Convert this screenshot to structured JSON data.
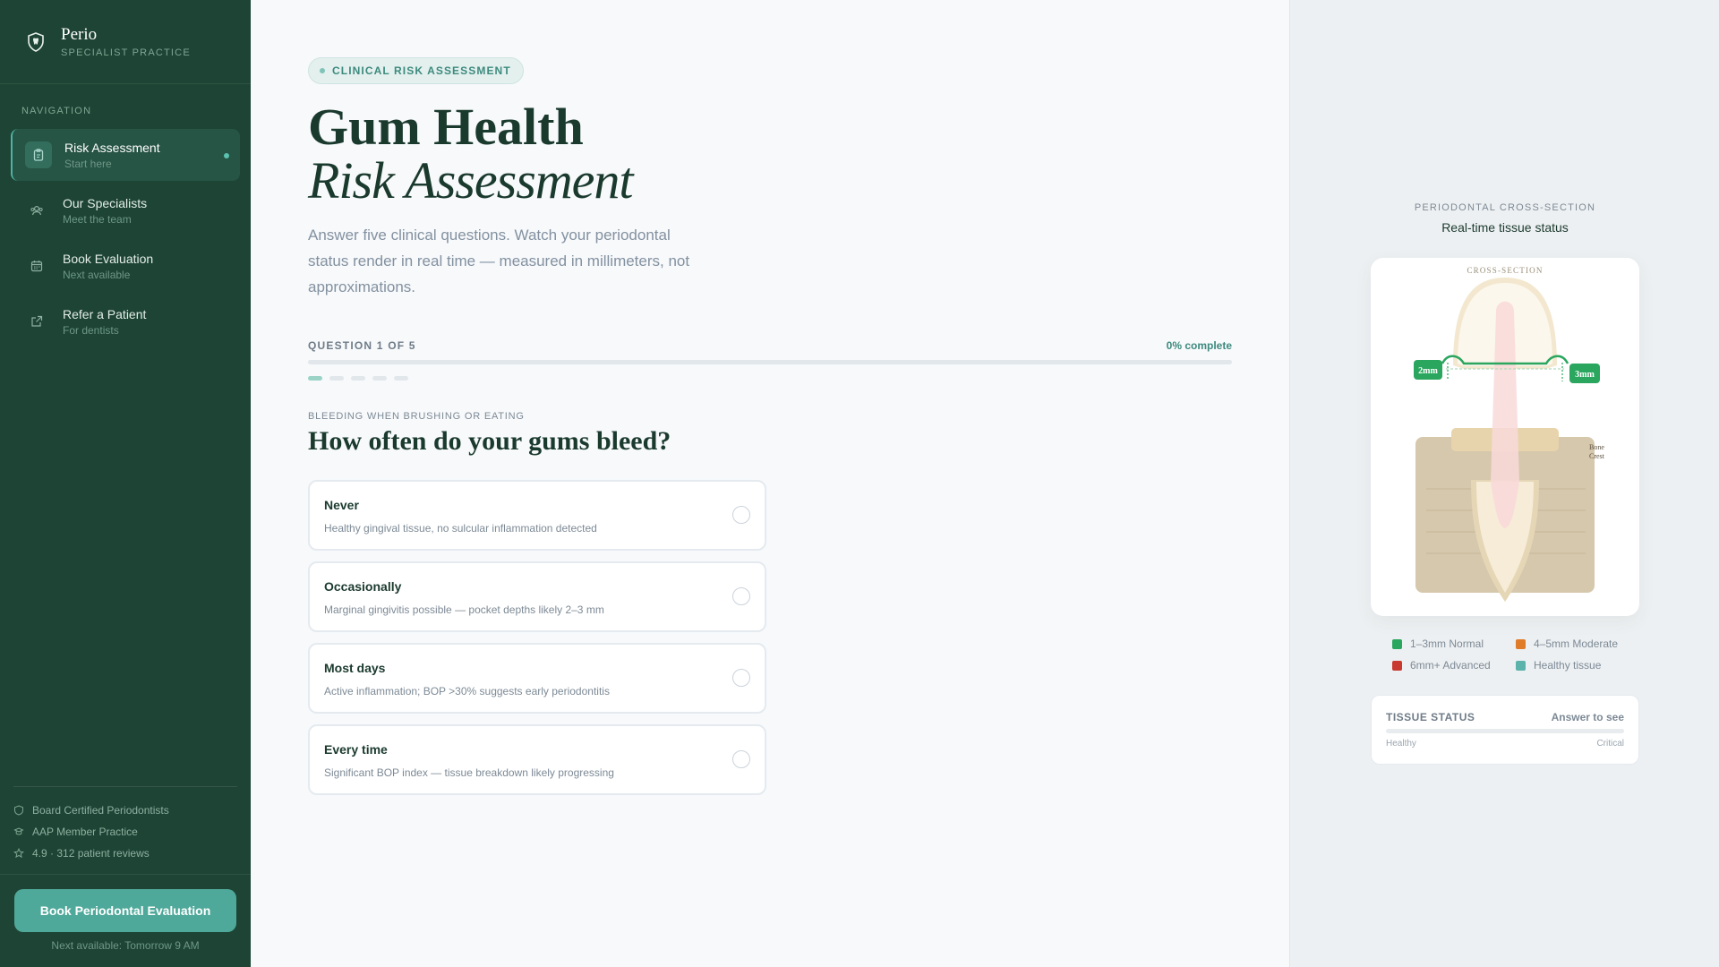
{
  "brand": {
    "name": "Perio",
    "tagline": "SPECIALIST PRACTICE"
  },
  "sidebar": {
    "nav_label": "NAVIGATION",
    "items": [
      {
        "title": "Risk Assessment",
        "subtitle": "Start here",
        "icon": "clipboard-icon",
        "active": true
      },
      {
        "title": "Our Specialists",
        "subtitle": "Meet the team",
        "icon": "team-icon",
        "active": false
      },
      {
        "title": "Book Evaluation",
        "subtitle": "Next available",
        "icon": "calendar-icon",
        "active": false
      },
      {
        "title": "Refer a Patient",
        "subtitle": "For dentists",
        "icon": "external-link-icon",
        "active": false
      }
    ],
    "trust": [
      {
        "text": "Board Certified Periodontists",
        "icon": "shield-icon"
      },
      {
        "text": "AAP Member Practice",
        "icon": "badge-icon"
      },
      {
        "text": "4.9 · 312 patient reviews",
        "icon": "star-icon"
      }
    ],
    "cta_label": "Book Periodontal Evaluation",
    "cta_note": "Next available: Tomorrow 9 AM"
  },
  "main": {
    "pill": "CLINICAL RISK ASSESSMENT",
    "title_line1": "Gum Health",
    "title_line2": "Risk Assessment",
    "lead": "Answer five clinical questions. Watch your periodontal status render in real time — measured in millimeters, not approximations.",
    "question_count": "QUESTION 1 OF 5",
    "progress_label": "0% complete",
    "progress": 0,
    "steps_total": 5,
    "step_current": 1,
    "question_category": "BLEEDING WHEN BRUSHING OR EATING",
    "question": "How often do your gums bleed?",
    "options": [
      {
        "title": "Never",
        "desc": "Healthy gingival tissue, no sulcular inflammation detected"
      },
      {
        "title": "Occasionally",
        "desc": "Marginal gingivitis possible — pocket depths likely 2–3 mm"
      },
      {
        "title": "Most days",
        "desc": "Active inflammation; BOP >30% suggests early periodontitis"
      },
      {
        "title": "Every time",
        "desc": "Significant BOP index — tissue breakdown likely progressing"
      }
    ]
  },
  "panel": {
    "eyebrow": "PERIODONTAL CROSS-SECTION",
    "title": "Real-time tissue status",
    "diagram": {
      "caption": "CROSS-SECTION",
      "left_depth": "2mm",
      "right_depth": "3mm",
      "bone_label_1": "Bone",
      "bone_label_2": "Crest"
    },
    "legend": [
      {
        "label": "1–3mm Normal",
        "color": "#2aa65e"
      },
      {
        "label": "4–5mm Moderate",
        "color": "#e07b2a"
      },
      {
        "label": "6mm+ Advanced",
        "color": "#c8392f"
      },
      {
        "label": "Healthy tissue",
        "color": "#5bb3ac"
      }
    ],
    "status": {
      "label": "TISSUE STATUS",
      "value": "Answer to see",
      "min": "Healthy",
      "max": "Critical"
    }
  }
}
